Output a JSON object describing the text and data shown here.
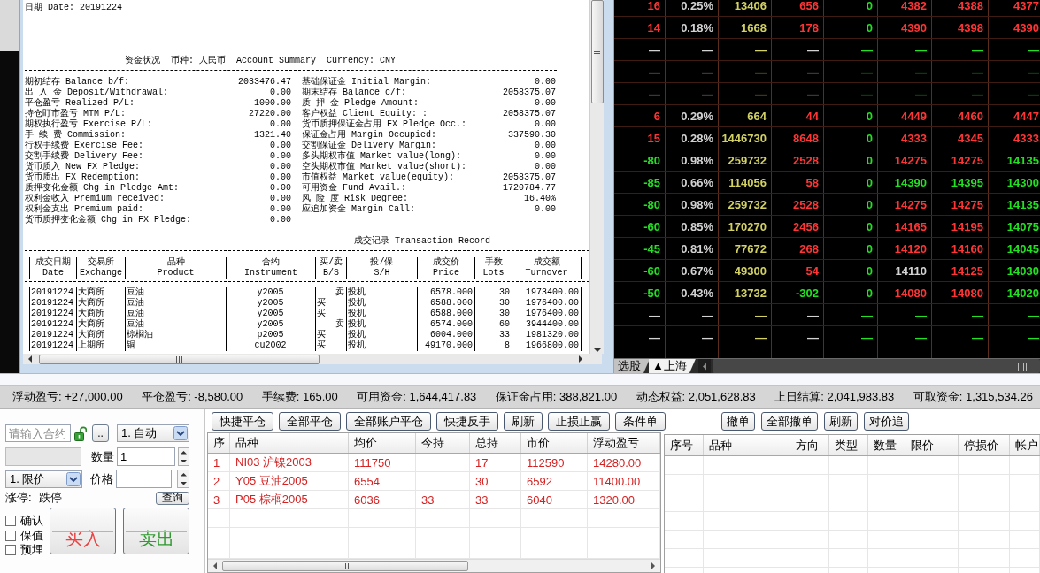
{
  "statement": {
    "date_line": "日期 Date: 20191224",
    "summary_title": "资金状况  币种: 人民币  Account Summary  Currency: CNY",
    "summary_left": [
      {
        "label": "期初结存 Balance b/f:",
        "value": "2033476.47"
      },
      {
        "label": "出 入 金 Deposit/Withdrawal:",
        "value": "0.00"
      },
      {
        "label": "平仓盈亏 Realized P/L:",
        "value": "-1000.00"
      },
      {
        "label": "持仓盯市盈亏 MTM P/L:",
        "value": "27220.00"
      },
      {
        "label": "期权执行盈亏 Exercise P/L:",
        "value": "0.00"
      },
      {
        "label": "手 续 费 Commission:",
        "value": "1321.40"
      },
      {
        "label": "行权手续费 Exercise Fee:",
        "value": "0.00"
      },
      {
        "label": "交割手续费 Delivery Fee:",
        "value": "0.00"
      },
      {
        "label": "货币质入 New FX Pledge:",
        "value": "0.00"
      },
      {
        "label": "货币质出 FX Redemption:",
        "value": "0.00"
      },
      {
        "label": "质押变化金额 Chg in Pledge Amt:",
        "value": "0.00"
      },
      {
        "label": "权利金收入 Premium received:",
        "value": "0.00"
      },
      {
        "label": "权利金支出 Premium paid:",
        "value": "0.00"
      },
      {
        "label": "货币质押变化金额 Chg in FX Pledge:",
        "value": "0.00"
      }
    ],
    "summary_right": [
      {
        "label": "基础保证金 Initial Margin:",
        "value": "0.00"
      },
      {
        "label": "期末结存 Balance c/f:",
        "value": "2058375.07"
      },
      {
        "label": "质 押 金 Pledge Amount:",
        "value": "0.00"
      },
      {
        "label": "客户权益 Client Equity: :",
        "value": "2058375.07"
      },
      {
        "label": "货币质押保证金占用 FX Pledge Occ.:",
        "value": "0.00"
      },
      {
        "label": "保证金占用 Margin Occupied:",
        "value": "337590.30"
      },
      {
        "label": "交割保证金 Delivery Margin:",
        "value": "0.00"
      },
      {
        "label": "多头期权市值 Market value(long):",
        "value": "0.00"
      },
      {
        "label": "空头期权市值 Market value(short):",
        "value": "0.00"
      },
      {
        "label": "市值权益 Market value(equity):",
        "value": "2058375.07"
      },
      {
        "label": "可用资金 Fund Avail.:",
        "value": "1720784.77"
      },
      {
        "label": "风 险 度 Risk Degree:",
        "value": "16.40%"
      },
      {
        "label": "应追加资金 Margin Call:",
        "value": "0.00"
      }
    ],
    "transactions_title": "成交记录 Transaction Record",
    "transaction_columns": [
      {
        "zh": "成交日期",
        "en": "Date"
      },
      {
        "zh": "交易所",
        "en": "Exchange"
      },
      {
        "zh": "品种",
        "en": "Product"
      },
      {
        "zh": "合约",
        "en": "Instrument"
      },
      {
        "zh": "买/卖",
        "en": "B/S"
      },
      {
        "zh": "投/保",
        "en": "S/H"
      },
      {
        "zh": "成交价",
        "en": "Price"
      },
      {
        "zh": "手数",
        "en": "Lots"
      },
      {
        "zh": "成交额",
        "en": "Turnover"
      }
    ],
    "transactions": [
      {
        "kind": "sell",
        "cells": [
          "20191224",
          "大商所",
          "豆油",
          "y2005",
          "卖",
          "投机",
          "6578.000",
          "30",
          "1973400.00"
        ]
      },
      {
        "kind": "buy",
        "cells": [
          "20191224",
          "大商所",
          "豆油",
          "y2005",
          "买",
          "投机",
          "6588.000",
          "30",
          "1976400.00"
        ]
      },
      {
        "kind": "buy",
        "cells": [
          "20191224",
          "大商所",
          "豆油",
          "y2005",
          "买",
          "投机",
          "6588.000",
          "30",
          "1976400.00"
        ]
      },
      {
        "kind": "sell",
        "cells": [
          "20191224",
          "大商所",
          "豆油",
          "y2005",
          "卖",
          "投机",
          "6574.000",
          "60",
          "3944400.00"
        ]
      },
      {
        "kind": "buy",
        "cells": [
          "20191224",
          "大商所",
          "棕榈油",
          "p2005",
          "买",
          "投机",
          "6004.000",
          "33",
          "1981320.00"
        ]
      },
      {
        "kind": "buy",
        "cells": [
          "20191224",
          "上期所",
          "铜",
          "cu2002",
          "买",
          "投机",
          "49170.000",
          "8",
          "1966800.00"
        ]
      }
    ]
  },
  "market_board": {
    "rows": [
      {
        "cells": [
          {
            "text": "16",
            "color": "#ff3535"
          },
          {
            "text": "0.25%",
            "color": "#d2d2d2"
          },
          {
            "text": "13406",
            "color": "#d2d162"
          },
          {
            "text": "656",
            "color": "#ff3535"
          },
          {
            "text": "0",
            "color": "#22e022"
          },
          {
            "text": "4382",
            "color": "#ff3535"
          },
          {
            "text": "4388",
            "color": "#ff3535"
          },
          {
            "text": "4377",
            "color": "#ff3535"
          }
        ]
      },
      {
        "cells": [
          {
            "text": "14",
            "color": "#ff3535"
          },
          {
            "text": "0.18%",
            "color": "#d2d2d2"
          },
          {
            "text": "1668",
            "color": "#d2d162"
          },
          {
            "text": "178",
            "color": "#ff3535"
          },
          {
            "text": "0",
            "color": "#22e022"
          },
          {
            "text": "4390",
            "color": "#ff3535"
          },
          {
            "text": "4398",
            "color": "#ff3535"
          },
          {
            "text": "4390",
            "color": "#ff3535"
          }
        ]
      },
      {
        "cells": [
          {
            "text": "—",
            "color": "#d2d2d2"
          },
          {
            "text": "—",
            "color": "#d2d2d2"
          },
          {
            "text": "—",
            "color": "#d2d162"
          },
          {
            "text": "—",
            "color": "#d2d2d2"
          },
          {
            "text": "—",
            "color": "#22e022"
          },
          {
            "text": "—",
            "color": "#22e022"
          },
          {
            "text": "—",
            "color": "#22e022"
          },
          {
            "text": "—",
            "color": "#22e022"
          }
        ]
      },
      {
        "cells": [
          {
            "text": "—",
            "color": "#d2d2d2"
          },
          {
            "text": "—",
            "color": "#d2d2d2"
          },
          {
            "text": "—",
            "color": "#d2d162"
          },
          {
            "text": "—",
            "color": "#d2d2d2"
          },
          {
            "text": "—",
            "color": "#22e022"
          },
          {
            "text": "—",
            "color": "#22e022"
          },
          {
            "text": "—",
            "color": "#22e022"
          },
          {
            "text": "—",
            "color": "#22e022"
          }
        ]
      },
      {
        "cells": [
          {
            "text": "—",
            "color": "#d2d2d2"
          },
          {
            "text": "—",
            "color": "#d2d2d2"
          },
          {
            "text": "—",
            "color": "#d2d162"
          },
          {
            "text": "—",
            "color": "#d2d2d2"
          },
          {
            "text": "—",
            "color": "#22e022"
          },
          {
            "text": "—",
            "color": "#22e022"
          },
          {
            "text": "—",
            "color": "#22e022"
          },
          {
            "text": "—",
            "color": "#22e022"
          }
        ]
      },
      {
        "cells": [
          {
            "text": "6",
            "color": "#ff3535"
          },
          {
            "text": "0.29%",
            "color": "#d2d2d2"
          },
          {
            "text": "664",
            "color": "#d2d162"
          },
          {
            "text": "44",
            "color": "#ff3535"
          },
          {
            "text": "0",
            "color": "#22e022"
          },
          {
            "text": "4449",
            "color": "#ff3535"
          },
          {
            "text": "4460",
            "color": "#ff3535"
          },
          {
            "text": "4447",
            "color": "#ff3535"
          }
        ]
      },
      {
        "cells": [
          {
            "text": "15",
            "color": "#ff3535"
          },
          {
            "text": "0.28%",
            "color": "#d2d2d2"
          },
          {
            "text": "1446730",
            "color": "#d2d162"
          },
          {
            "text": "8648",
            "color": "#ff3535"
          },
          {
            "text": "0",
            "color": "#22e022"
          },
          {
            "text": "4333",
            "color": "#ff3535"
          },
          {
            "text": "4345",
            "color": "#ff3535"
          },
          {
            "text": "4333",
            "color": "#ff3535"
          }
        ]
      },
      {
        "cells": [
          {
            "text": "-80",
            "color": "#22e022"
          },
          {
            "text": "0.98%",
            "color": "#d2d2d2"
          },
          {
            "text": "259732",
            "color": "#d2d162"
          },
          {
            "text": "2528",
            "color": "#ff3535"
          },
          {
            "text": "0",
            "color": "#22e022"
          },
          {
            "text": "14275",
            "color": "#ff3535"
          },
          {
            "text": "14275",
            "color": "#ff3535"
          },
          {
            "text": "14135",
            "color": "#22e022"
          }
        ]
      },
      {
        "cells": [
          {
            "text": "-85",
            "color": "#22e022"
          },
          {
            "text": "0.66%",
            "color": "#d2d2d2"
          },
          {
            "text": "114056",
            "color": "#d2d162"
          },
          {
            "text": "58",
            "color": "#ff3535"
          },
          {
            "text": "0",
            "color": "#22e022"
          },
          {
            "text": "14390",
            "color": "#22e022"
          },
          {
            "text": "14395",
            "color": "#22e022"
          },
          {
            "text": "14300",
            "color": "#22e022"
          }
        ]
      },
      {
        "cells": [
          {
            "text": "-80",
            "color": "#22e022"
          },
          {
            "text": "0.98%",
            "color": "#d2d2d2"
          },
          {
            "text": "259732",
            "color": "#d2d162"
          },
          {
            "text": "2528",
            "color": "#ff3535"
          },
          {
            "text": "0",
            "color": "#22e022"
          },
          {
            "text": "14275",
            "color": "#ff3535"
          },
          {
            "text": "14275",
            "color": "#ff3535"
          },
          {
            "text": "14135",
            "color": "#22e022"
          }
        ]
      },
      {
        "cells": [
          {
            "text": "-60",
            "color": "#22e022"
          },
          {
            "text": "0.85%",
            "color": "#d2d2d2"
          },
          {
            "text": "170270",
            "color": "#d2d162"
          },
          {
            "text": "2456",
            "color": "#ff3535"
          },
          {
            "text": "0",
            "color": "#22e022"
          },
          {
            "text": "14165",
            "color": "#ff3535"
          },
          {
            "text": "14195",
            "color": "#ff3535"
          },
          {
            "text": "14075",
            "color": "#22e022"
          }
        ]
      },
      {
        "cells": [
          {
            "text": "-45",
            "color": "#22e022"
          },
          {
            "text": "0.81%",
            "color": "#d2d2d2"
          },
          {
            "text": "77672",
            "color": "#d2d162"
          },
          {
            "text": "268",
            "color": "#ff3535"
          },
          {
            "text": "0",
            "color": "#22e022"
          },
          {
            "text": "14120",
            "color": "#ff3535"
          },
          {
            "text": "14160",
            "color": "#ff3535"
          },
          {
            "text": "14045",
            "color": "#22e022"
          }
        ]
      },
      {
        "cells": [
          {
            "text": "-60",
            "color": "#22e022"
          },
          {
            "text": "0.67%",
            "color": "#d2d2d2"
          },
          {
            "text": "49300",
            "color": "#d2d162"
          },
          {
            "text": "54",
            "color": "#ff3535"
          },
          {
            "text": "0",
            "color": "#22e022"
          },
          {
            "text": "14110",
            "color": "#d2d2d2"
          },
          {
            "text": "14125",
            "color": "#ff3535"
          },
          {
            "text": "14030",
            "color": "#22e022"
          }
        ]
      },
      {
        "cells": [
          {
            "text": "-50",
            "color": "#22e022"
          },
          {
            "text": "0.43%",
            "color": "#d2d2d2"
          },
          {
            "text": "13732",
            "color": "#d2d162"
          },
          {
            "text": "-302",
            "color": "#22e022"
          },
          {
            "text": "0",
            "color": "#22e022"
          },
          {
            "text": "14080",
            "color": "#ff3535"
          },
          {
            "text": "14080",
            "color": "#ff3535"
          },
          {
            "text": "14020",
            "color": "#22e022"
          }
        ]
      },
      {
        "cells": [
          {
            "text": "—",
            "color": "#d2d2d2"
          },
          {
            "text": "—",
            "color": "#d2d2d2"
          },
          {
            "text": "—",
            "color": "#d2d162"
          },
          {
            "text": "—",
            "color": "#d2d2d2"
          },
          {
            "text": "—",
            "color": "#22e022"
          },
          {
            "text": "—",
            "color": "#22e022"
          },
          {
            "text": "—",
            "color": "#22e022"
          },
          {
            "text": "—",
            "color": "#22e022"
          }
        ]
      },
      {
        "cells": [
          {
            "text": "—",
            "color": "#d2d2d2"
          },
          {
            "text": "—",
            "color": "#d2d2d2"
          },
          {
            "text": "—",
            "color": "#d2d162"
          },
          {
            "text": "—",
            "color": "#d2d2d2"
          },
          {
            "text": "—",
            "color": "#22e022"
          },
          {
            "text": "—",
            "color": "#22e022"
          },
          {
            "text": "—",
            "color": "#22e022"
          },
          {
            "text": "—",
            "color": "#22e022"
          }
        ]
      }
    ],
    "tabs": [
      {
        "label": "选股",
        "selected": false
      },
      {
        "label": "▲上海",
        "selected": true
      }
    ]
  },
  "status_bar": [
    "浮动盈亏: +27,000.00",
    "平仓盈亏: -8,580.00",
    "手续费: 165.00",
    "可用资金: 1,644,417.83",
    "保证金占用: 388,821.00",
    "动态权益: 2,051,628.83",
    "上日结算: 2,041,983.83",
    "可取资金: 1,315,534.26"
  ],
  "order_form": {
    "contract_field": {
      "placeholder": "请输入合约"
    },
    "browse_button": "..",
    "mode_select": "1. 自动",
    "name_field": {
      "disabled": true
    },
    "quantity_label": "数量",
    "quantity_field": {
      "value": "1"
    },
    "price_type_select": "1. 限价",
    "price_label": "价格",
    "limit_up_label": "涨停:",
    "limit_down_label": "跌停",
    "query_button": "查询",
    "options": [
      {
        "label": "确认",
        "checked": false
      },
      {
        "label": "保值",
        "checked": false
      },
      {
        "label": "预埋",
        "checked": false
      }
    ],
    "buy_button": "买入",
    "sell_button": "卖出"
  },
  "positions": {
    "buttons": [
      "快捷平仓",
      "全部平仓",
      "全部账户平仓",
      "快捷反手",
      "刷新",
      "止损止赢",
      "条件单"
    ],
    "columns": [
      "序",
      "品种",
      "均价",
      "今持",
      "总持",
      "市价",
      "浮动盈亏"
    ],
    "rows": [
      {
        "index": "1",
        "product": "NI03 沪镍2003",
        "avg_price": "111750",
        "total": "17",
        "market_price": "112590",
        "floating_pl": "14280.00"
      },
      {
        "index": "2",
        "product": "Y05 豆油2005",
        "avg_price": "6554",
        "total": "30",
        "market_price": "6592",
        "floating_pl": "11400.00"
      },
      {
        "index": "3",
        "product": "P05 棕榈2005",
        "avg_price": "6036",
        "today": "33",
        "total": "33",
        "market_price": "6040",
        "floating_pl": "1320.00"
      }
    ]
  },
  "orders": {
    "buttons": [
      "撤单",
      "全部撤单",
      "刷新",
      "对价追"
    ],
    "columns": [
      "序号",
      "品种",
      "方向",
      "类型",
      "数量",
      "限价",
      "停损价",
      "帐户"
    ]
  }
}
